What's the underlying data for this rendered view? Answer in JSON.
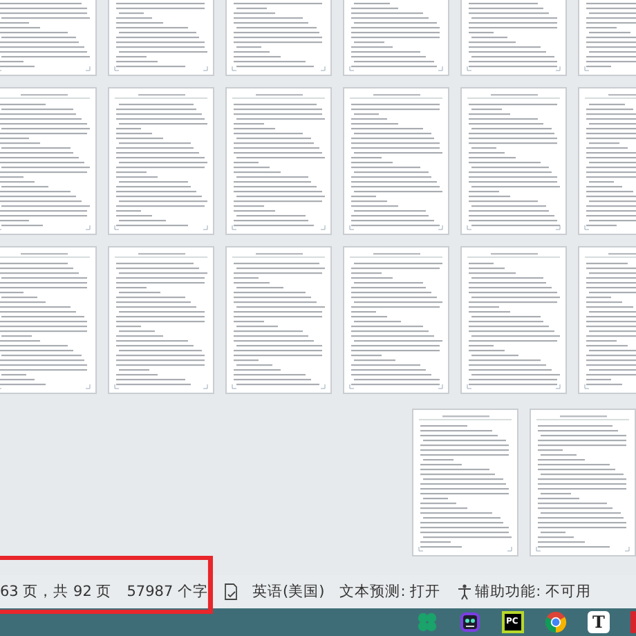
{
  "status_bar": {
    "page_info": "63 页，共 92 页",
    "word_count": "57987 个字",
    "language": "英语(美国)",
    "text_prediction": "文本预测: 打开",
    "accessibility": "辅助功能: 不可用"
  },
  "taskbar": {
    "items": [
      {
        "kind": "clover"
      },
      {
        "kind": "bot"
      },
      {
        "kind": "ide",
        "label": "PC"
      },
      {
        "kind": "browser"
      },
      {
        "kind": "editor",
        "label": "T"
      },
      {
        "kind": "partial"
      }
    ]
  }
}
